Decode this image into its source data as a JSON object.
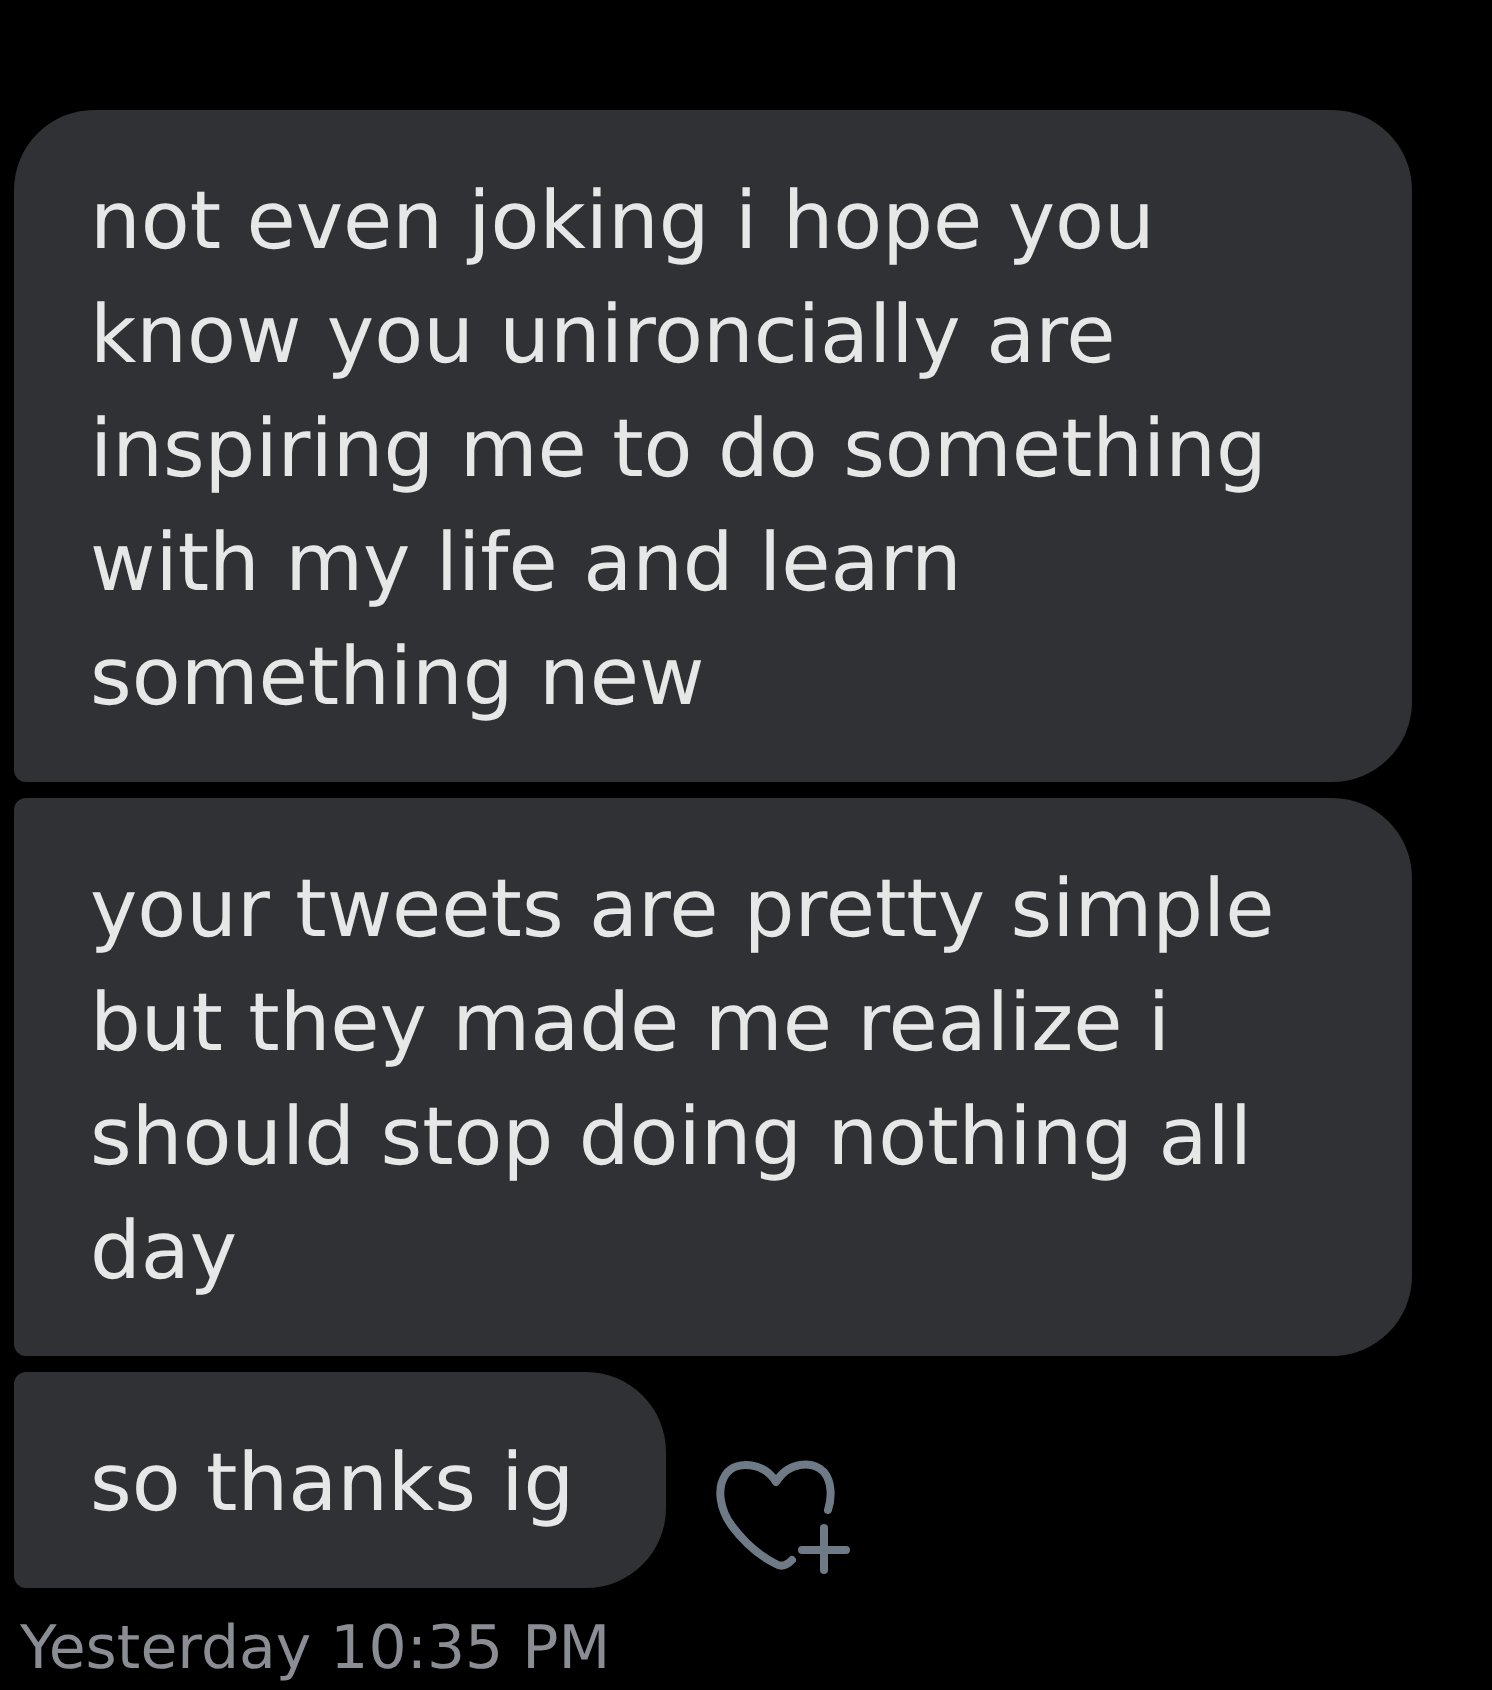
{
  "messages": [
    {
      "text": "not even joking i hope you know you unironcially are inspiring me to do something with my life and learn something new"
    },
    {
      "text": "your tweets are pretty simple but they made me realize i should stop doing nothing all day"
    },
    {
      "text": "so thanks ig"
    }
  ],
  "timestamp": "Yesterday 10:35 PM"
}
